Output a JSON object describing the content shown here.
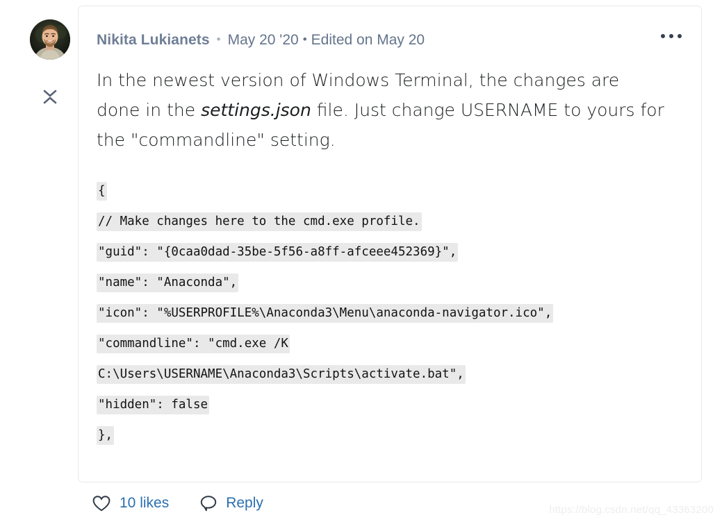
{
  "comment": {
    "author": {
      "name": "Nikita Lukianets",
      "avatar_icon": "user-photo-avatar"
    },
    "separator": "•",
    "date": "May 20 '20",
    "edited": "Edited on May 20",
    "more_menu_icon": "more-horizontal-icon",
    "collapse_icon": "collapse-chevrons-icon",
    "body": {
      "part1": "In the newest version of Windows Terminal, the changes are done in the ",
      "italic": "settings.json",
      "part2": " file. Just change USERNAME to yours for the \"commandline\" setting."
    },
    "code_lines": [
      "{",
      "// Make changes here to the cmd.exe profile.",
      "\"guid\": \"{0caa0dad-35be-5f56-a8ff-afceee452369}\",",
      "\"name\": \"Anaconda\",",
      "\"icon\": \"%USERPROFILE%\\Anaconda3\\Menu\\anaconda-navigator.ico\",",
      "\"commandline\": \"cmd.exe /K",
      "C:\\Users\\USERNAME\\Anaconda3\\Scripts\\activate.bat\",",
      "\"hidden\": false",
      "},"
    ]
  },
  "actions": {
    "like": {
      "icon": "heart-icon",
      "label": "10 likes"
    },
    "reply": {
      "icon": "speech-bubble-icon",
      "label": "Reply"
    }
  },
  "watermark": "https://blog.csdn.net/qq_43363200",
  "colors": {
    "author": "#6e7e95",
    "meta": "#64748b",
    "link": "#2a6fb0",
    "code_bg": "#e9e9e9",
    "card_border": "#e8e8e8"
  }
}
